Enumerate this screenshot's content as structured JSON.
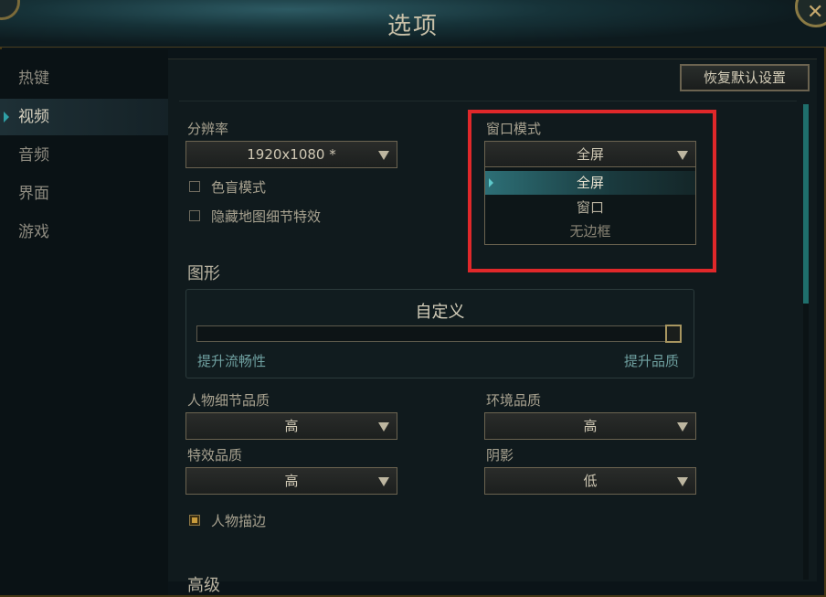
{
  "window": {
    "title": "选项"
  },
  "sidebar": {
    "items": [
      {
        "label": "热键"
      },
      {
        "label": "视频"
      },
      {
        "label": "音频"
      },
      {
        "label": "界面"
      },
      {
        "label": "游戏"
      }
    ],
    "active": "视频"
  },
  "toolbar": {
    "reset_label": "恢复默认设置"
  },
  "resolution": {
    "label": "分辨率",
    "value": "1920x1080 *"
  },
  "checkboxes": {
    "colorblind": {
      "label": "色盲模式",
      "checked": false
    },
    "hide_map_detail": {
      "label": "隐藏地图细节特效",
      "checked": false
    },
    "character_outline": {
      "label": "人物描边",
      "checked": true
    }
  },
  "window_mode": {
    "label": "窗口模式",
    "value": "全屏",
    "options": [
      "全屏",
      "窗口",
      "无边框"
    ],
    "highlight_color": "#e0282a"
  },
  "graphics": {
    "title": "图形",
    "preset": "自定义",
    "left_label": "提升流畅性",
    "right_label": "提升品质",
    "slider_level": 1.0
  },
  "quality": {
    "character": {
      "label": "人物细节品质",
      "value": "高"
    },
    "environment": {
      "label": "环境品质",
      "value": "高"
    },
    "effects": {
      "label": "特效品质",
      "value": "高"
    },
    "shadows": {
      "label": "阴影",
      "value": "低"
    }
  },
  "advanced": {
    "title": "高级"
  },
  "colors": {
    "accent": "#2fa0a6",
    "gold": "#c89b3c",
    "text": "#a09b8c"
  }
}
